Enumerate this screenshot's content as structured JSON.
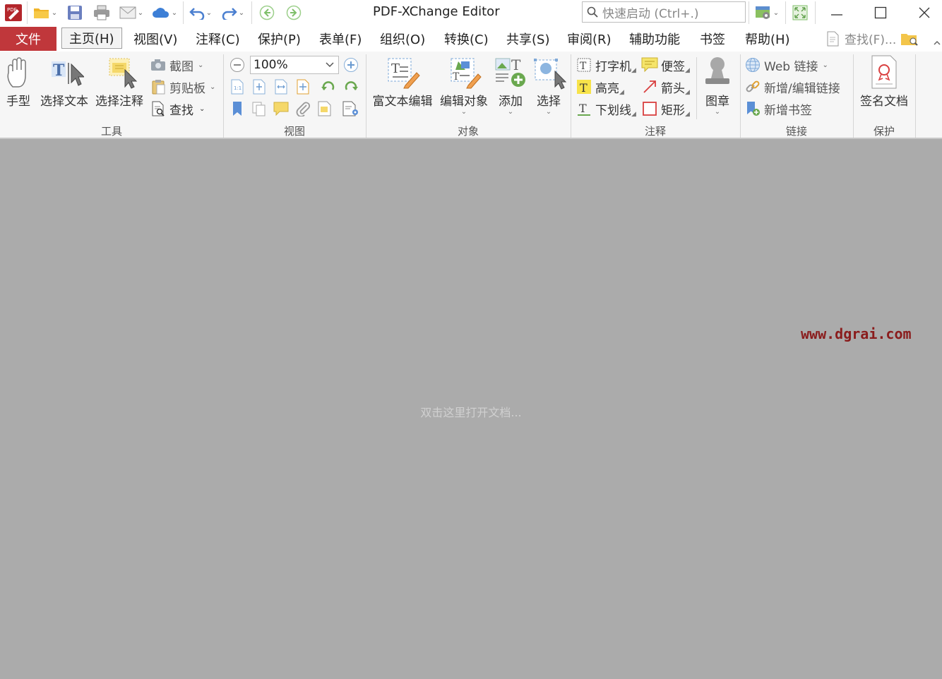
{
  "window": {
    "title": "PDF-XChange Editor",
    "search_placeholder": "快速启动 (Ctrl+.)"
  },
  "menu": {
    "file": "文件",
    "items": [
      "主页(H)",
      "视图(V)",
      "注释(C)",
      "保护(P)",
      "表单(F)",
      "组织(O)",
      "转换(C)",
      "共享(S)",
      "审阅(R)",
      "辅助功能",
      "书签",
      "帮助(H)"
    ],
    "find": "查找(F)..."
  },
  "ribbon": {
    "tools": {
      "label": "工具",
      "hand": "手型",
      "select_text": "选择文本",
      "select_comment": "选择注释",
      "snapshot": "截图",
      "clipboard": "剪贴板",
      "find": "查找"
    },
    "view": {
      "label": "视图",
      "zoom": "100%"
    },
    "objects": {
      "label": "对象",
      "rich_text": "富文本编辑",
      "edit_object": "编辑对象",
      "add": "添加",
      "select": "选择"
    },
    "comment": {
      "label": "注释",
      "typewriter": "打字机",
      "sticky": "便签",
      "highlight": "高亮",
      "arrow": "箭头",
      "underline": "下划线",
      "rectangle": "矩形",
      "stamp": "图章"
    },
    "links": {
      "label": "链接",
      "web": "Web 链接",
      "add_edit": "新增/编辑链接",
      "bookmark": "新增书签"
    },
    "protect": {
      "label": "保护",
      "sign": "签名文档"
    }
  },
  "workarea": {
    "placeholder": "双击这里打开文档...",
    "watermark": "www.dgrai.com"
  },
  "colors": {
    "file_tab": "#c0373b",
    "workarea": "#ababab",
    "ribbon": "#f6f6f6"
  }
}
